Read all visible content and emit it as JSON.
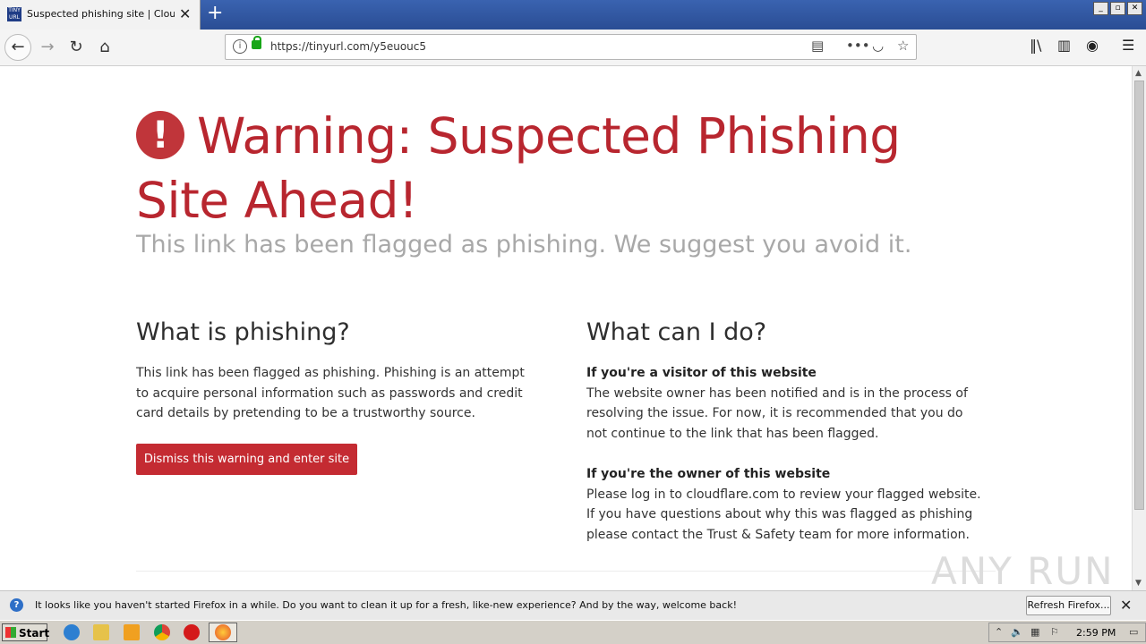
{
  "browser": {
    "tab_title": "Suspected phishing site | Cloudflare",
    "tab_favicon_text": "TINY URL",
    "url": "https://tinyurl.com/y5euouc5"
  },
  "page": {
    "heading": "Warning: Suspected Phishing Site Ahead!",
    "subtitle": "This link has been flagged as phishing. We suggest you avoid it.",
    "left": {
      "heading": "What is phishing?",
      "body": "This link has been flagged as phishing. Phishing is an attempt to acquire personal information such as passwords and credit card details by pretending to be a trustworthy source.",
      "dismiss_label": "Dismiss this warning and enter site"
    },
    "right": {
      "heading": "What can I do?",
      "visitor_title": "If you're a visitor of this website",
      "visitor_body": "The website owner has been notified and is in the process of resolving the issue. For now, it is recommended that you do not continue to the link that has been flagged.",
      "owner_title": "If you're the owner of this website",
      "owner_body": "Please log in to cloudflare.com to review your flagged website. If you have questions about why this was flagged as phishing please contact the Trust & Safety team for more information."
    },
    "watermark": "ANY RUN"
  },
  "notification": {
    "message": "It looks like you haven't started Firefox in a while. Do you want to clean it up for a fresh, like-new experience? And by the way, welcome back!",
    "refresh_label": "Refresh Firefox..."
  },
  "taskbar": {
    "start_label": "Start",
    "clock": "2:59 PM"
  },
  "colors": {
    "accent_red": "#b8262f",
    "button_red": "#c42b32",
    "subtitle_gray": "#a8a8a8"
  }
}
